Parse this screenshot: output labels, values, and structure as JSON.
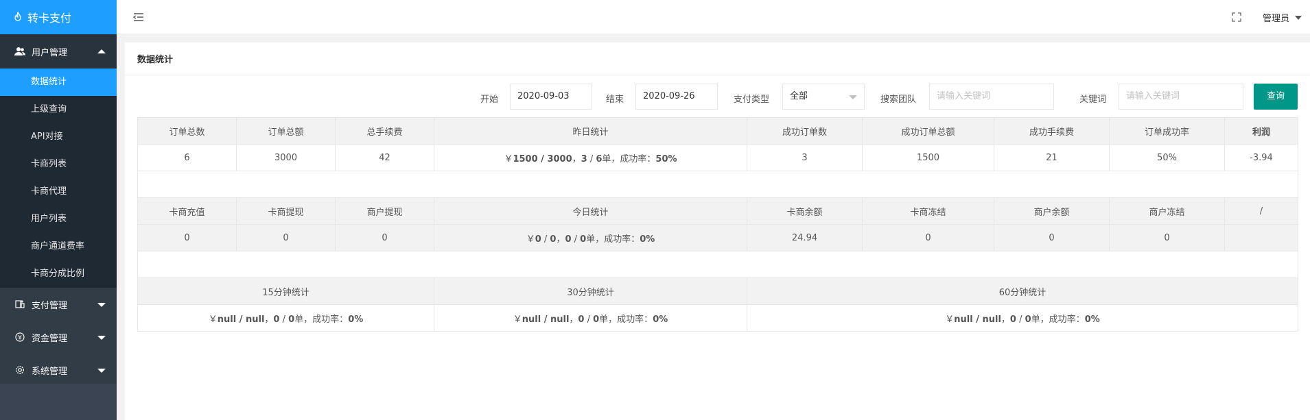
{
  "sidebar": {
    "logo": "转卡支付",
    "groups": [
      {
        "label": "用户管理",
        "icon": "users-icon",
        "open": true,
        "items": [
          "数据统计",
          "上级查询",
          "API对接",
          "卡商列表",
          "卡商代理",
          "用户列表",
          "商户通道费率",
          "卡商分成比例"
        ]
      },
      {
        "label": "支付管理",
        "icon": "payment-icon"
      },
      {
        "label": "资金管理",
        "icon": "yen-icon"
      },
      {
        "label": "系统管理",
        "icon": "gear-icon"
      }
    ]
  },
  "header": {
    "user": "管理员"
  },
  "page": {
    "title": "数据统计"
  },
  "filters": {
    "start_label": "开始",
    "start_value": "2020-09-03",
    "end_label": "结束",
    "end_value": "2020-09-26",
    "paytype_label": "支付类型",
    "paytype_value": "全部",
    "team_label": "搜索团队",
    "team_placeholder": "请输入关键词",
    "keyword_label": "关键词",
    "keyword_placeholder": "请输入关键词",
    "query_button": "查询"
  },
  "table1": {
    "headers": [
      "订单总数",
      "订单总额",
      "总手续费",
      "昨日统计",
      "成功订单数",
      "成功订单总额",
      "成功手续费",
      "订单成功率",
      "利润"
    ],
    "values": [
      "6",
      "3000",
      "42",
      "",
      "3",
      "1500",
      "21",
      "50%",
      "-3.94"
    ],
    "yesterday": {
      "currency": "￥",
      "a": "1500",
      "sep1": " / ",
      "b": "3000",
      "comma": "，",
      "c": "3",
      "sep2": " / ",
      "d": "6",
      "unit": "单，成功率：",
      "rate": "50%"
    }
  },
  "table2": {
    "headers": [
      "卡商充值",
      "卡商提现",
      "商户提现",
      "今日统计",
      "卡商余额",
      "卡商冻结",
      "商户余额",
      "商户冻结",
      "/"
    ],
    "values": [
      "0",
      "0",
      "0",
      "",
      "24.94",
      "0",
      "0",
      "0",
      ""
    ],
    "today": {
      "currency": "￥",
      "a": "0",
      "sep1": " / ",
      "b": "0",
      "comma": "，",
      "c": "0",
      "sep2": " / ",
      "d": "0",
      "unit": "单，成功率：",
      "rate": "0%"
    }
  },
  "table3": {
    "headers": [
      "15分钟统计",
      "30分钟统计",
      "60分钟统计"
    ],
    "cells": [
      {
        "currency": "￥",
        "a": "null",
        "sep1": " / ",
        "b": "null",
        "comma": "，",
        "c": "0",
        "sep2": " / ",
        "d": "0",
        "unit": "单，成功率：",
        "rate": "0%"
      },
      {
        "currency": "￥",
        "a": "null",
        "sep1": " / ",
        "b": "null",
        "comma": "，",
        "c": "0",
        "sep2": " / ",
        "d": "0",
        "unit": "单，成功率：",
        "rate": "0%"
      },
      {
        "currency": "￥",
        "a": "null",
        "sep1": " / ",
        "b": "null",
        "comma": "，",
        "c": "0",
        "sep2": " / ",
        "d": "0",
        "unit": "单，成功率：",
        "rate": "0%"
      }
    ]
  },
  "colors": {
    "sidebar": "#28333e",
    "accent": "#1e9fff",
    "query": "#009688"
  }
}
